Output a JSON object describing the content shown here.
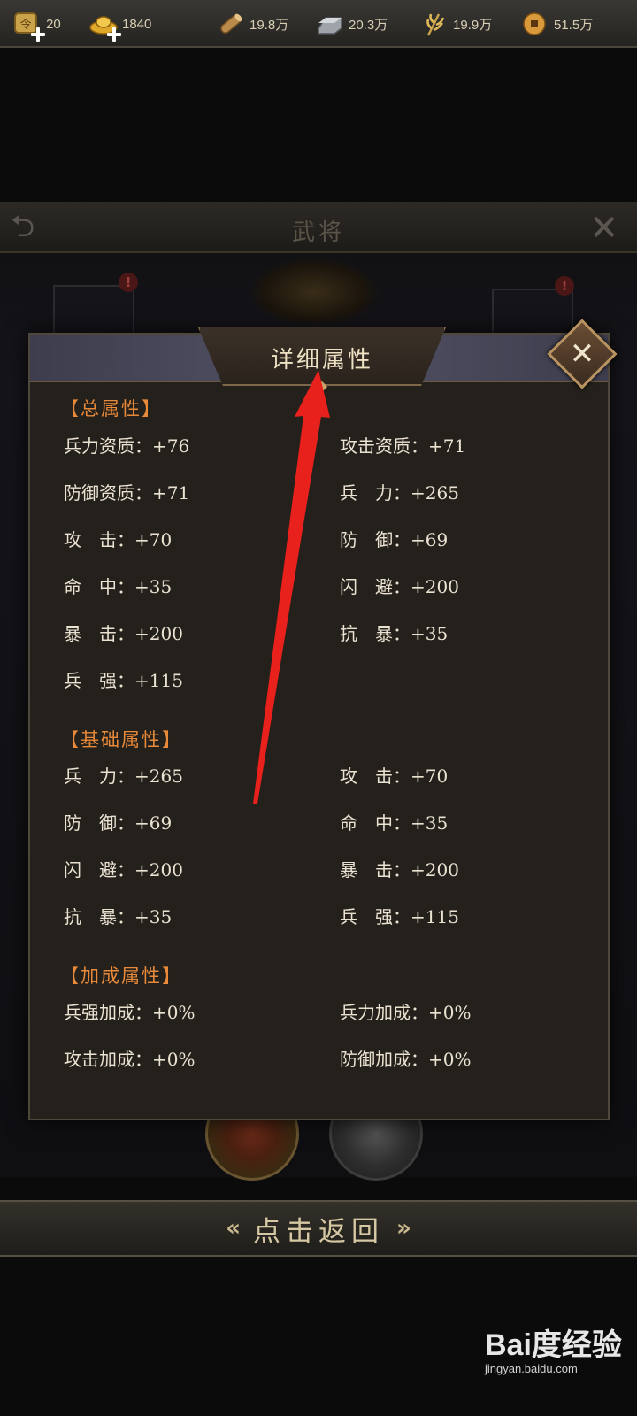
{
  "top_bar": {
    "resources": [
      {
        "name": "tokens",
        "value": "20"
      },
      {
        "name": "gold",
        "value": "1840"
      },
      {
        "name": "wood",
        "value": "19.8万"
      },
      {
        "name": "iron",
        "value": "20.3万"
      },
      {
        "name": "grain",
        "value": "19.9万"
      },
      {
        "name": "coins",
        "value": "51.5万"
      }
    ]
  },
  "background": {
    "title": "武将",
    "warn_badge": "!"
  },
  "modal": {
    "title": "详细属性",
    "close_glyph": "✕",
    "sections": {
      "total": {
        "title": "【总属性】",
        "items": [
          "兵力资质：+76",
          "攻击资质：+71",
          "防御资质：+71",
          "兵　力：+265",
          "攻　击：+70",
          "防　御：+69",
          "命　中：+35",
          "闪　避：+200",
          "暴　击：+200",
          "抗　暴：+35",
          "兵　强：+115"
        ]
      },
      "base": {
        "title": "【基础属性】",
        "items": [
          "兵　力：+265",
          "攻　击：+70",
          "防　御：+69",
          "命　中：+35",
          "闪　避：+200",
          "暴　击：+200",
          "抗　暴：+35",
          "兵　强：+115"
        ]
      },
      "bonus": {
        "title": "【加成属性】",
        "items": [
          "兵强加成：+0%",
          "兵力加成：+0%",
          "攻击加成：+0%",
          "防御加成：+0%"
        ]
      }
    }
  },
  "return_bar": {
    "label": "点击返回",
    "left_chevron": "«",
    "right_chevron": "»"
  },
  "watermark": {
    "logo": "Bai度经验",
    "url": "jingyan.baidu.com"
  },
  "colors": {
    "section_title": "#e98a3a",
    "attr_text": "#ebe3d2",
    "annotation_arrow": "#e8211c"
  }
}
